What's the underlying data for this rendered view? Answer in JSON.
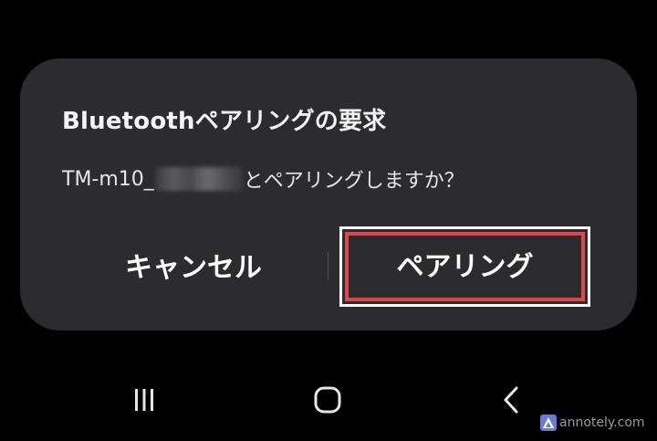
{
  "dialog": {
    "title": "Bluetoothペアリングの要求",
    "message_prefix": "TM-m10_",
    "message_suffix": "とペアリングしますか？",
    "cancel_label": "キャンセル",
    "pair_label": "ペアリング"
  },
  "navbar": {
    "recent_icon": "recent-apps-icon",
    "home_icon": "home-icon",
    "back_icon": "back-icon"
  },
  "watermark": {
    "text": "annotely.com"
  },
  "colors": {
    "dialog_bg": "#2c2c2e",
    "highlight_red": "#e0474c",
    "text": "#ffffff"
  }
}
